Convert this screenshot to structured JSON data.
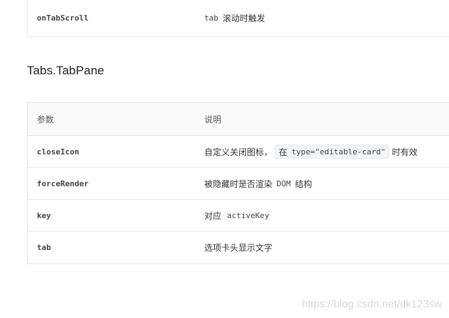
{
  "prev_table": {
    "row": {
      "param": "onTabScroll",
      "desc_code": "tab",
      "desc_text": "滚动时触发"
    }
  },
  "section_title": "Tabs.TabPane",
  "table": {
    "headers": {
      "param": "参数",
      "desc": "说明"
    },
    "rows": [
      {
        "param": "closeIcon",
        "desc_prefix": "自定义关闭图标，",
        "code_prefix": "在",
        "code": "type=\"editable-card\"",
        "desc_suffix": "时有效"
      },
      {
        "param": "forceRender",
        "desc_prefix": "被隐藏时是否渲染",
        "code": "DOM",
        "desc_suffix": "结构"
      },
      {
        "param": "key",
        "desc_prefix": "对应",
        "code": "activeKey"
      },
      {
        "param": "tab",
        "desc_prefix": "选项卡头显示文字"
      }
    ]
  },
  "watermark": "https://blog.csdn.net/dk123sw"
}
